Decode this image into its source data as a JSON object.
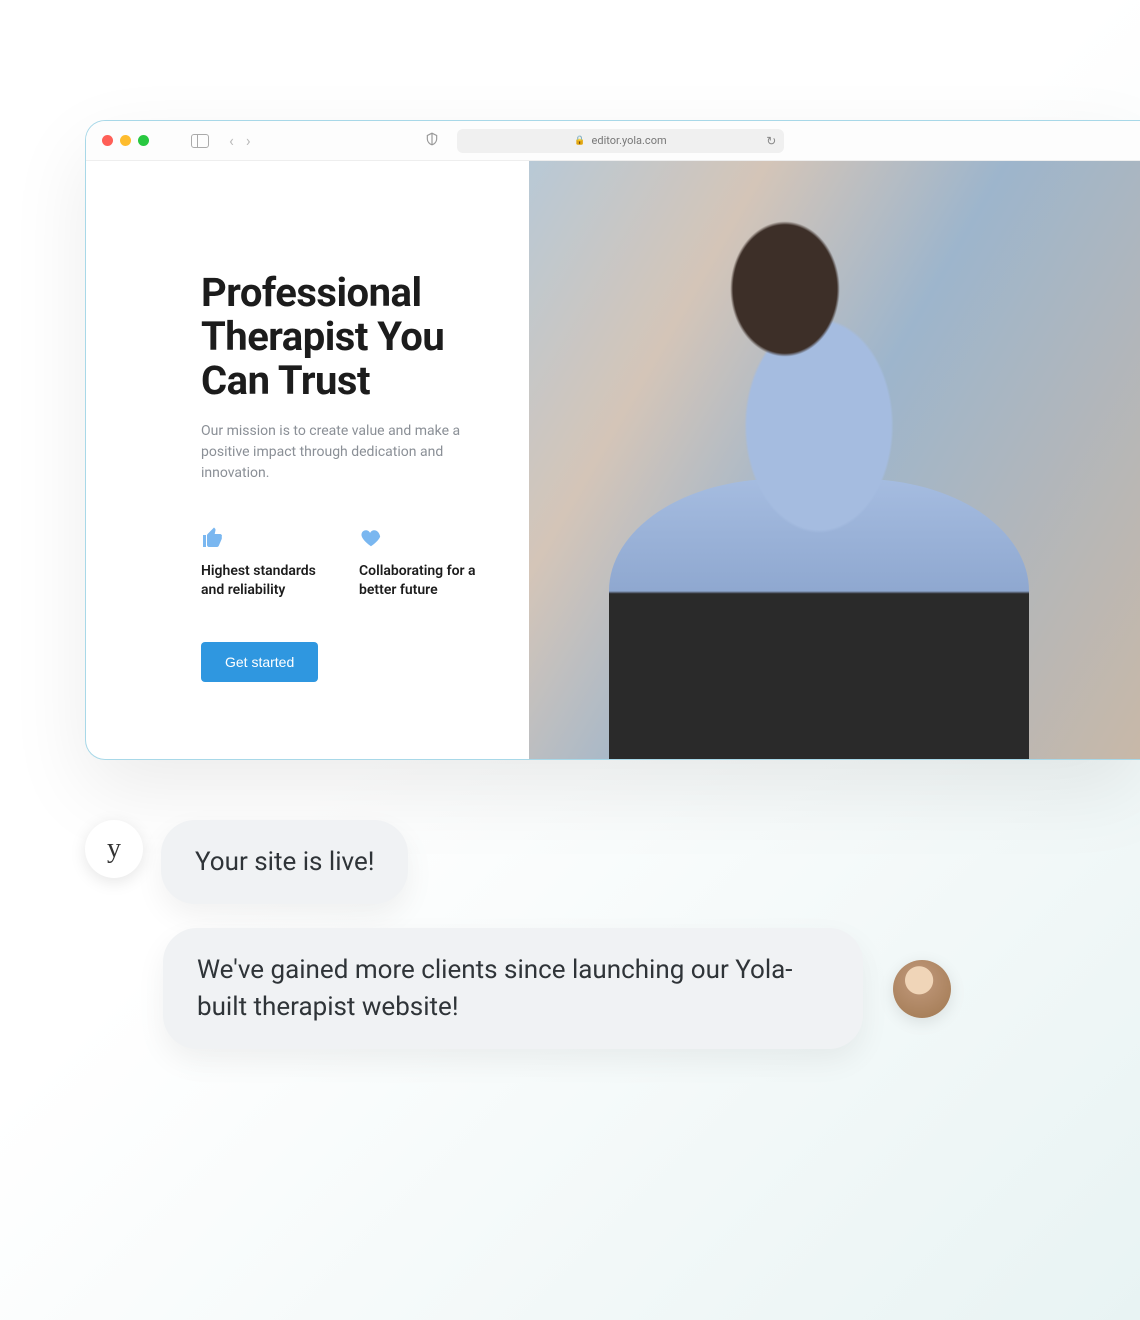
{
  "browser": {
    "url_display": "editor.yola.com",
    "traffic_colors": {
      "red": "#ff5f57",
      "yellow": "#febc2e",
      "green": "#28c840"
    }
  },
  "page": {
    "hero_title": "Professional Therapist You Can Trust",
    "mission": "Our mission is to create value and make a positive impact through dedication and innovation.",
    "features": [
      {
        "icon": "thumbs-up-icon",
        "label": "Highest standards and reliability"
      },
      {
        "icon": "heart-icon",
        "label": "Collaborating for a better future"
      }
    ],
    "cta_label": "Get started",
    "hero_image_alt": "Therapist speaking with client"
  },
  "chat": {
    "brand_avatar_letter": "y",
    "messages": [
      {
        "sender": "brand",
        "text": "Your site is live!"
      },
      {
        "sender": "user",
        "text": "We've gained more clients since launching our Yola-built therapist website!"
      }
    ]
  },
  "colors": {
    "accent_blue": "#2f97e0",
    "icon_blue": "#7ab7f0"
  }
}
